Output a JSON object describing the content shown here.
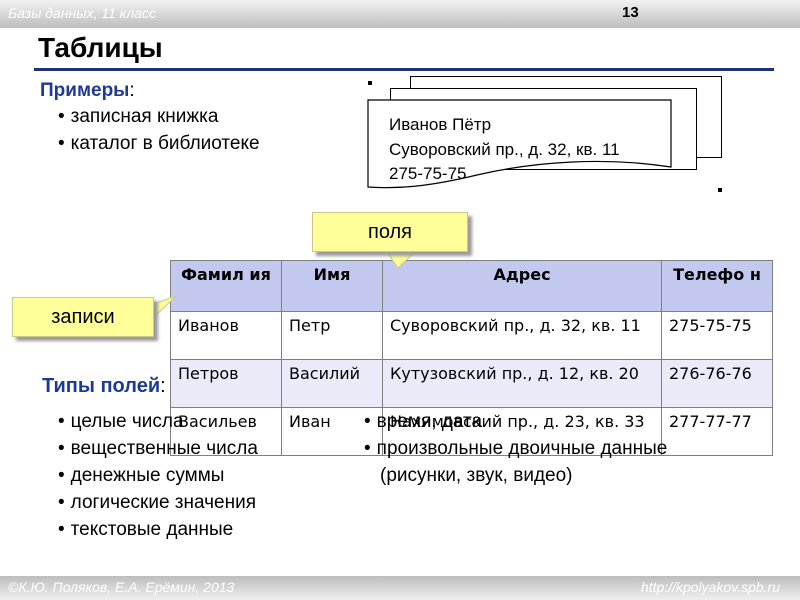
{
  "header": {
    "course": "Базы данных, 11 класс",
    "page_number": "13"
  },
  "title": "Таблицы",
  "examples": {
    "heading": "Примеры",
    "colon": ":",
    "items": [
      "записная книжка",
      "каталог в библиотеке"
    ]
  },
  "card": {
    "line1": "Иванов Пётр",
    "line2": "Суворовский пр., д. 32, кв. 11",
    "line3": "275-75-75"
  },
  "callouts": {
    "fields": "поля",
    "records": "записи"
  },
  "table": {
    "headers": [
      "Фамил ия",
      "Имя",
      "Адрес",
      "Телефо н"
    ],
    "rows": [
      [
        "Иванов",
        "Петр",
        "Суворовский пр., д. 32, кв. 11",
        "275-75-75"
      ],
      [
        "Петров",
        "Василий",
        "Кутузовский пр., д. 12, кв. 20",
        "276-76-76"
      ],
      [
        "Васильев",
        "Иван",
        "Нахимовский пр., д. 23, кв. 33",
        "277-77-77"
      ]
    ]
  },
  "types": {
    "heading": "Типы полей",
    "colon": ":",
    "left": [
      "целые числа",
      "вещественные числа",
      "денежные суммы",
      "логические значения",
      "текстовые данные"
    ],
    "right": [
      "время, дата",
      "произвольные двоичные данные",
      "(рисунки, звук, видео)"
    ]
  },
  "footer": {
    "authors": "©К.Ю. Поляков, Е.А. Ерёмин, 2013",
    "url": "http://kpolyakov.spb.ru"
  },
  "colors": {
    "accent": "#1e3a99",
    "title_rule": "#1f2f7a",
    "table_header": "#c3c8ee",
    "table_alt_row": "#eaeaf8",
    "callout": "#ffff99"
  }
}
